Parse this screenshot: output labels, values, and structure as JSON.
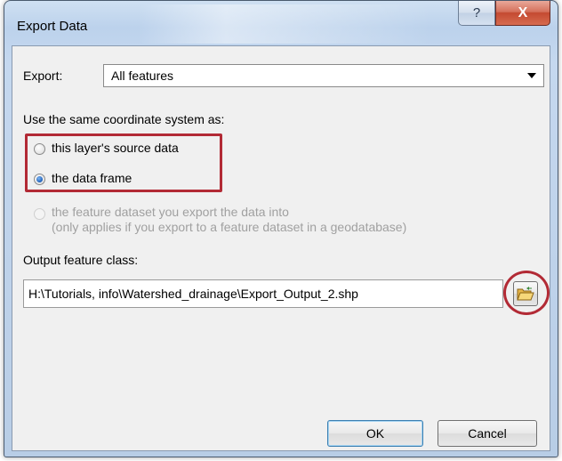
{
  "window": {
    "title": "Export Data",
    "help_label": "?",
    "close_label": "X"
  },
  "export": {
    "label": "Export:",
    "selected": "All features"
  },
  "coordinate": {
    "label": "Use the same coordinate system as:",
    "options": [
      {
        "label": "this layer's source data",
        "checked": false,
        "enabled": true
      },
      {
        "label": "the data frame",
        "checked": true,
        "enabled": true
      },
      {
        "label": "the feature dataset you export the data into",
        "checked": false,
        "enabled": false
      }
    ],
    "dataset_note": "(only applies if you export to a feature dataset in a geodatabase)"
  },
  "output": {
    "label": "Output feature class:",
    "value": "H:\\Tutorials, info\\Watershed_drainage\\Export_Output_2.shp",
    "browse_icon": "open-folder-icon"
  },
  "buttons": {
    "ok": "OK",
    "cancel": "Cancel"
  },
  "annotation_color": "#b22a35"
}
